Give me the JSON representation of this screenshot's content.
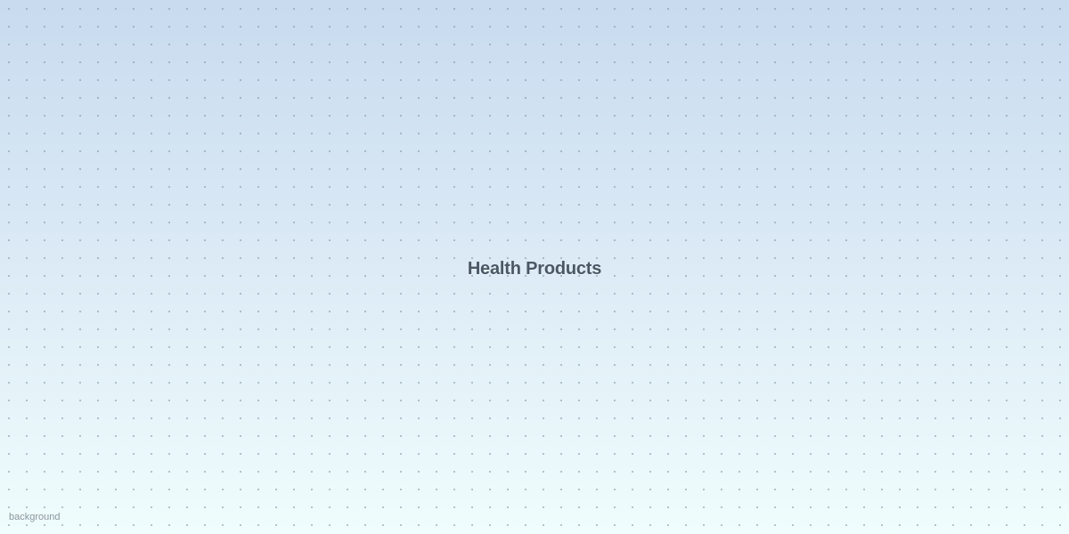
{
  "page": {
    "title": "Health Products",
    "corner_label": "background"
  },
  "colors": {
    "gradient_top": "#c8dbef",
    "gradient_bottom": "#f0fdfd",
    "title_text": "#4a5866",
    "dot_color": "#788c9b"
  }
}
